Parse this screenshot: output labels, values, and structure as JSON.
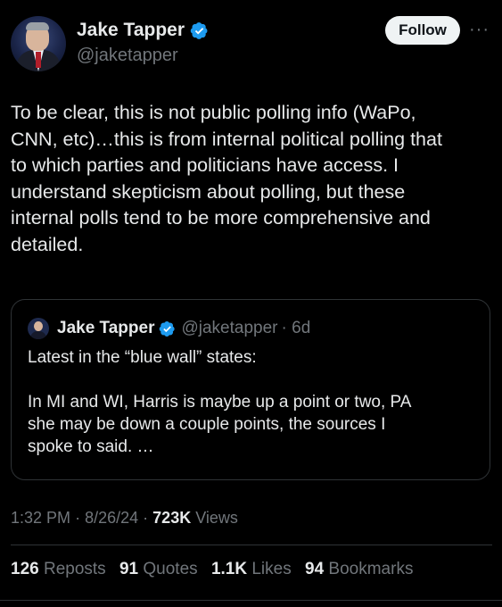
{
  "author": {
    "name": "Jake Tapper",
    "handle": "@jaketapper"
  },
  "actions": {
    "follow_label": "Follow",
    "more_label": "···"
  },
  "tweet": {
    "text": "To be clear, this is not public polling info (WaPo,\nCNN, etc)…this is from internal political polling that\nto which parties and politicians have access. I\nunderstand skepticism about polling, but these\ninternal polls tend to be more comprehensive and\ndetailed."
  },
  "quoted": {
    "name": "Jake Tapper",
    "handle": "@jaketapper",
    "age": "· 6d",
    "text": "Latest in the “blue wall” states:\n\nIn MI and WI, Harris is maybe up a point or two, PA\nshe may be down a couple points, the sources I\nspoke to said. …"
  },
  "meta": {
    "time": "1:32 PM",
    "date": "8/26/24",
    "separator": "·",
    "views_count": "723K",
    "views_label": "Views"
  },
  "stats": {
    "reposts_count": "126",
    "reposts_label": "Reposts",
    "quotes_count": "91",
    "quotes_label": "Quotes",
    "likes_count": "1.1K",
    "likes_label": "Likes",
    "bookmarks_count": "94",
    "bookmarks_label": "Bookmarks"
  },
  "colors": {
    "background": "#000000",
    "text": "#e7e9ea",
    "secondary": "#71767b",
    "verified": "#1d9bf0",
    "border": "#2f3336"
  },
  "icons": {
    "verified": "verified-badge-icon",
    "more": "more-horizontal-icon"
  }
}
